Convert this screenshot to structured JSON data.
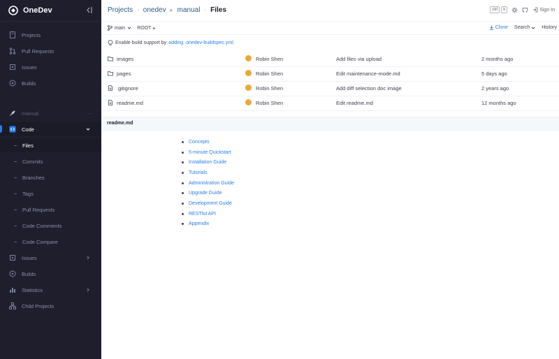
{
  "app": {
    "name": "OneDev"
  },
  "sidebar": {
    "top_items": [
      {
        "label": "Projects",
        "icon": "projects-icon"
      },
      {
        "label": "Pull Requests",
        "icon": "pull-request-icon"
      },
      {
        "label": "Issues",
        "icon": "issues-icon"
      },
      {
        "label": "Builds",
        "icon": "builds-icon"
      }
    ],
    "project": {
      "label": "manual",
      "more": "..."
    },
    "code": {
      "label": "Code"
    },
    "code_items": [
      {
        "label": "Files",
        "active": true
      },
      {
        "label": "Commits"
      },
      {
        "label": "Branches"
      },
      {
        "label": "Tags"
      },
      {
        "label": "Pull Requests"
      },
      {
        "label": "Code Comments"
      },
      {
        "label": "Code Compare"
      }
    ],
    "bottom_items": [
      {
        "label": "Issues",
        "icon": "issues-icon",
        "has_chevron": true
      },
      {
        "label": "Builds",
        "icon": "builds-icon"
      },
      {
        "label": "Statistics",
        "icon": "statistics-icon",
        "has_chevron": true
      },
      {
        "label": "Child Projects",
        "icon": "child-projects-icon"
      }
    ]
  },
  "breadcrumb": {
    "projects": "Projects",
    "sep1": "·",
    "onedev": "onedev",
    "sep2": "▸",
    "manual": "manual",
    "sep3": "·",
    "current": "Files"
  },
  "topbar": {
    "shortcut_ctrl": "ctrl",
    "shortcut_key": "k",
    "sign_in": "Sign In"
  },
  "toolbar": {
    "branch": "main",
    "path": "ROOT",
    "path_arrow": "▸",
    "clone": "Clone",
    "search": "Search",
    "history": "History"
  },
  "banner": {
    "text": "Enable build support by",
    "link": "adding .onedev-buildspec.yml"
  },
  "files": [
    {
      "name": "images",
      "type": "folder",
      "author": "Robin Shen",
      "message": "Add files via upload",
      "when": "2 months ago"
    },
    {
      "name": "pages",
      "type": "folder",
      "author": "Robin Shen",
      "message": "Edit maintenance-mode.md",
      "when": "5 days ago"
    },
    {
      "name": ".gitignore",
      "type": "file",
      "author": "Robin Shen",
      "message": "Add diff selection doc image",
      "when": "2 years ago"
    },
    {
      "name": "readme.md",
      "type": "file",
      "author": "Robin Shen",
      "message": "Edit readme.md",
      "when": "12 months ago"
    }
  ],
  "readme": {
    "title": "readme.md",
    "links": [
      "Concepts",
      "5-minute Quickstart",
      "Installation Guide",
      "Tutorials",
      "Administration Guide",
      "Upgrade Guide",
      "Development Guide",
      "RESTful API",
      "Appendix"
    ]
  },
  "colors": {
    "sidebar_bg": "#1e1e2d",
    "accent": "#2b7de9",
    "link": "#2b5c93"
  }
}
